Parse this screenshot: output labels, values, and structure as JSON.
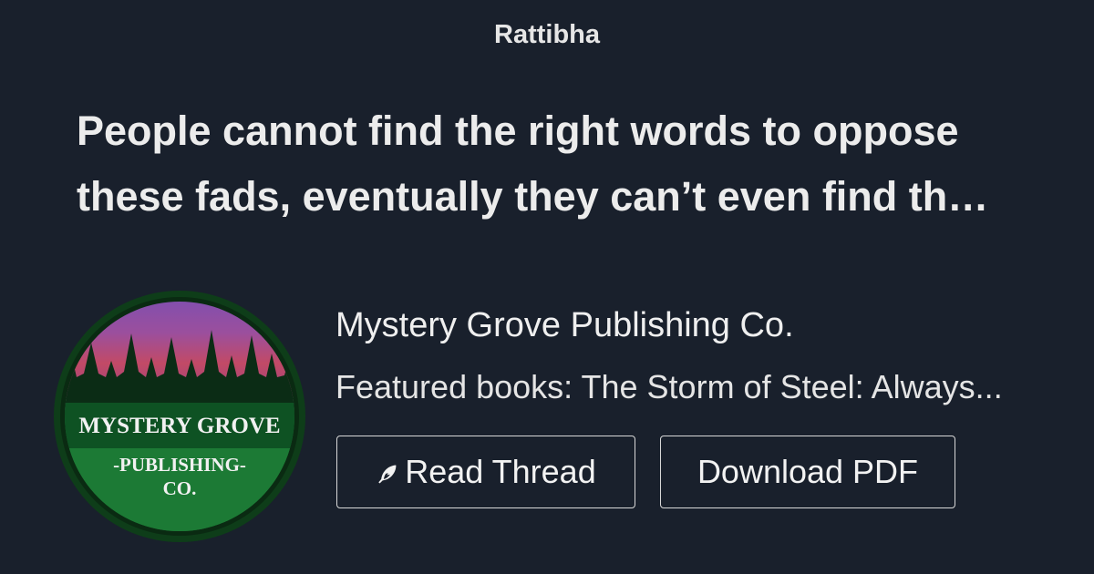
{
  "site": {
    "name": "Rattibha"
  },
  "thread": {
    "title_line_1": "People cannot find the right words to oppose",
    "title_line_2": "these fads, eventually they can’t even find th…"
  },
  "author": {
    "name": "Mystery Grove Publishing Co.",
    "bio": "Featured books: The Storm of Steel: Always...",
    "logo": {
      "text_line_1": "MYSTERY GROVE",
      "text_line_2": "-PUBLISHING-",
      "text_line_3": "CO.",
      "colors": {
        "ring": "#0f4a1d",
        "badge_green": "#1f8a3c",
        "sky_top": "#8a5bbf",
        "sky_mid": "#c24a6a",
        "sky_low": "#9a3f8e",
        "trees": "#0c2f16"
      }
    }
  },
  "actions": {
    "read_thread_label": "Read Thread",
    "download_pdf_label": "Download PDF"
  },
  "icons": {
    "read_thread_icon": "feather-icon"
  },
  "colors": {
    "background": "#19202c",
    "text": "#eeeeee",
    "button_border": "#d8d8d8"
  }
}
